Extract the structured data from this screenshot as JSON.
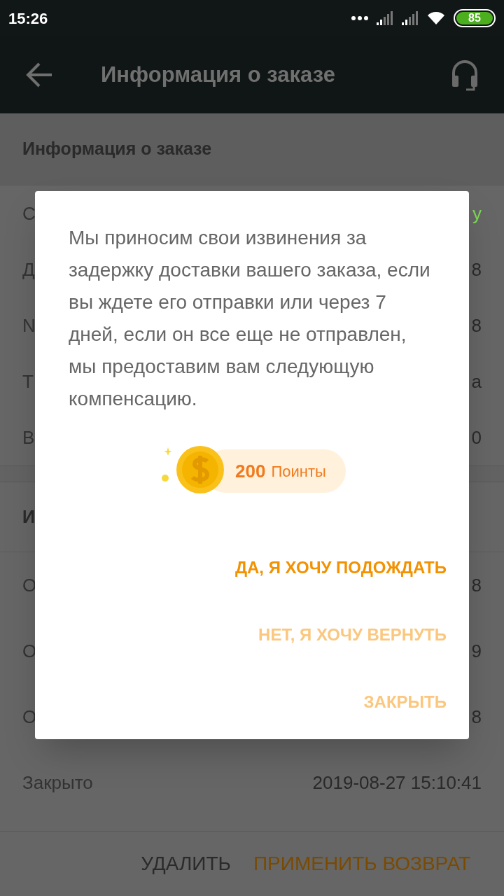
{
  "status_bar": {
    "time": "15:26",
    "battery": "85"
  },
  "header": {
    "title": "Информация о заказе"
  },
  "sections": [
    {
      "title": "Информация о заказе",
      "rows": [
        {
          "label": "С",
          "value": "у",
          "kind": "status"
        },
        {
          "label": "Д",
          "value": "8",
          "kind": "plain"
        },
        {
          "label": "N",
          "value": "8",
          "kind": "plain"
        },
        {
          "label": "Т",
          "value": "а",
          "kind": "plain"
        },
        {
          "label": "В",
          "value": "0",
          "kind": "plain"
        }
      ]
    },
    {
      "title": "И",
      "rows": [
        {
          "label": "О",
          "value": "8",
          "kind": "plain"
        },
        {
          "label": "О",
          "value": "9",
          "kind": "plain"
        },
        {
          "label": "О",
          "value": "8",
          "kind": "plain"
        },
        {
          "label": "Закрыто",
          "value": "2019-08-27 15:10:41",
          "kind": "plain"
        }
      ]
    }
  ],
  "dialog": {
    "message": "Мы приносим свои извинения за задержку доставки вашего заказа, если вы ждете его отправки или через 7 дней, если он все еще не отправлен, мы предоставим вам следующую компенсацию.",
    "reward": {
      "amount": "200",
      "unit": "Поинты"
    },
    "actions": [
      {
        "label": "ДА, Я ХОЧУ ПОДОЖДАТЬ",
        "kind": "primary"
      },
      {
        "label": "НЕТ, Я ХОЧУ ВЕРНУТЬ",
        "kind": "secondary"
      },
      {
        "label": "ЗАКРЫТЬ",
        "kind": "secondary"
      }
    ]
  },
  "bottom_bar": {
    "actions": [
      {
        "label": "УДАЛИТЬ",
        "kind": "secondary"
      },
      {
        "label": "ПРИМЕНИТЬ ВОЗВРАТ",
        "kind": "primary"
      }
    ]
  }
}
